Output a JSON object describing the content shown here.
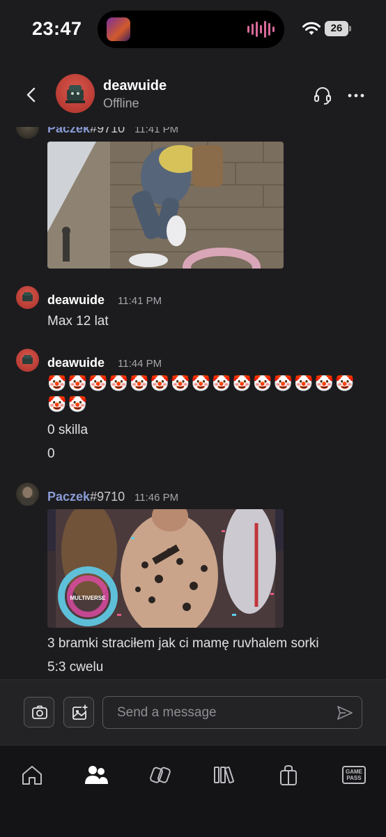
{
  "status_bar": {
    "time": "23:47",
    "battery": "26"
  },
  "header": {
    "title": "deawuide",
    "subtitle": "Offline"
  },
  "messages": [
    {
      "author": "Paczek",
      "tag": "#9710",
      "time": "11:41 PM"
    },
    {
      "author": "deawuide",
      "time": "11:41 PM",
      "text": "Max 12 lat"
    },
    {
      "author": "deawuide",
      "time": "11:44 PM",
      "emoji": "🤡",
      "lines": [
        "0 skilla",
        "0"
      ]
    },
    {
      "author": "Paczek",
      "tag": "#9710",
      "time": "11:46 PM",
      "image_caption": "MULTIVERSE",
      "text1": "3 bramki straciłem jak ci mamę ruvhalem sorki",
      "text2": "5:3 cwelu"
    }
  ],
  "composer": {
    "placeholder": "Send a message"
  },
  "bottom_nav": {
    "gamepass_line1": "GAME",
    "gamepass_line2": "PASS"
  },
  "colors": {
    "background": "#1c1c1e",
    "username_other": "#8a9bd6",
    "avatar_red": "#c4433b"
  }
}
